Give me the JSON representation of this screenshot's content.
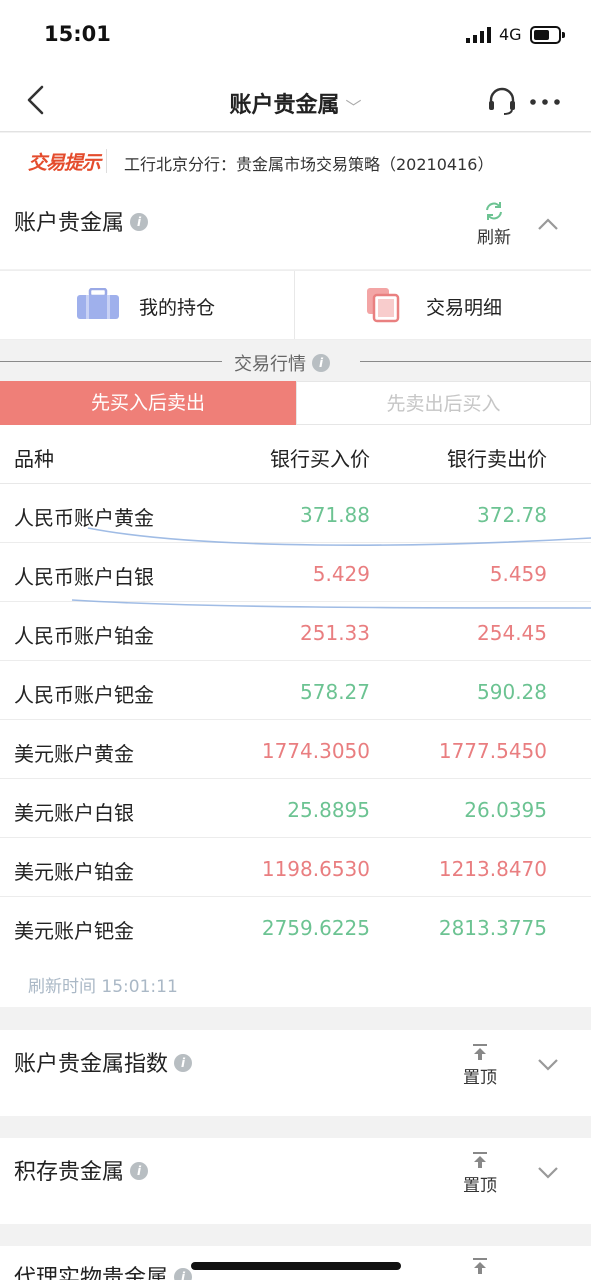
{
  "status_bar": {
    "time": "15:01",
    "network": "4G"
  },
  "nav": {
    "title": "账户贵金属"
  },
  "notice": {
    "badge": "交易提示",
    "text": "工行北京分行：贵金属市场交易策略（20210416）"
  },
  "section": {
    "title": "账户贵金属",
    "refresh_label": "刷新"
  },
  "shortcuts": {
    "holdings": "我的持仓",
    "details": "交易明细"
  },
  "market": {
    "title": "交易行情",
    "tabs": [
      "先买入后卖出",
      "先卖出后买入"
    ],
    "columns": [
      "品种",
      "银行买入价",
      "银行卖出价"
    ],
    "rows": [
      {
        "name": "人民币账户黄金",
        "buy": "371.88",
        "sell": "372.78",
        "color": "green"
      },
      {
        "name": "人民币账户白银",
        "buy": "5.429",
        "sell": "5.459",
        "color": "red"
      },
      {
        "name": "人民币账户铂金",
        "buy": "251.33",
        "sell": "254.45",
        "color": "red"
      },
      {
        "name": "人民币账户钯金",
        "buy": "578.27",
        "sell": "590.28",
        "color": "green"
      },
      {
        "name": "美元账户黄金",
        "buy": "1774.3050",
        "sell": "1777.5450",
        "color": "red"
      },
      {
        "name": "美元账户白银",
        "buy": "25.8895",
        "sell": "26.0395",
        "color": "green"
      },
      {
        "name": "美元账户铂金",
        "buy": "1198.6530",
        "sell": "1213.8470",
        "color": "red"
      },
      {
        "name": "美元账户钯金",
        "buy": "2759.6225",
        "sell": "2813.3775",
        "color": "green"
      }
    ],
    "refresh_time": "刷新时间 15:01:11"
  },
  "cards": [
    {
      "title": "账户贵金属指数",
      "pin_label": "置顶"
    },
    {
      "title": "积存贵金属",
      "pin_label": "置顶"
    },
    {
      "title": "代理实物贵金属",
      "pin_label": "置顶"
    }
  ],
  "colors": {
    "up": "#6cc392",
    "down": "#e97e80",
    "accent": "#ef7f78"
  }
}
